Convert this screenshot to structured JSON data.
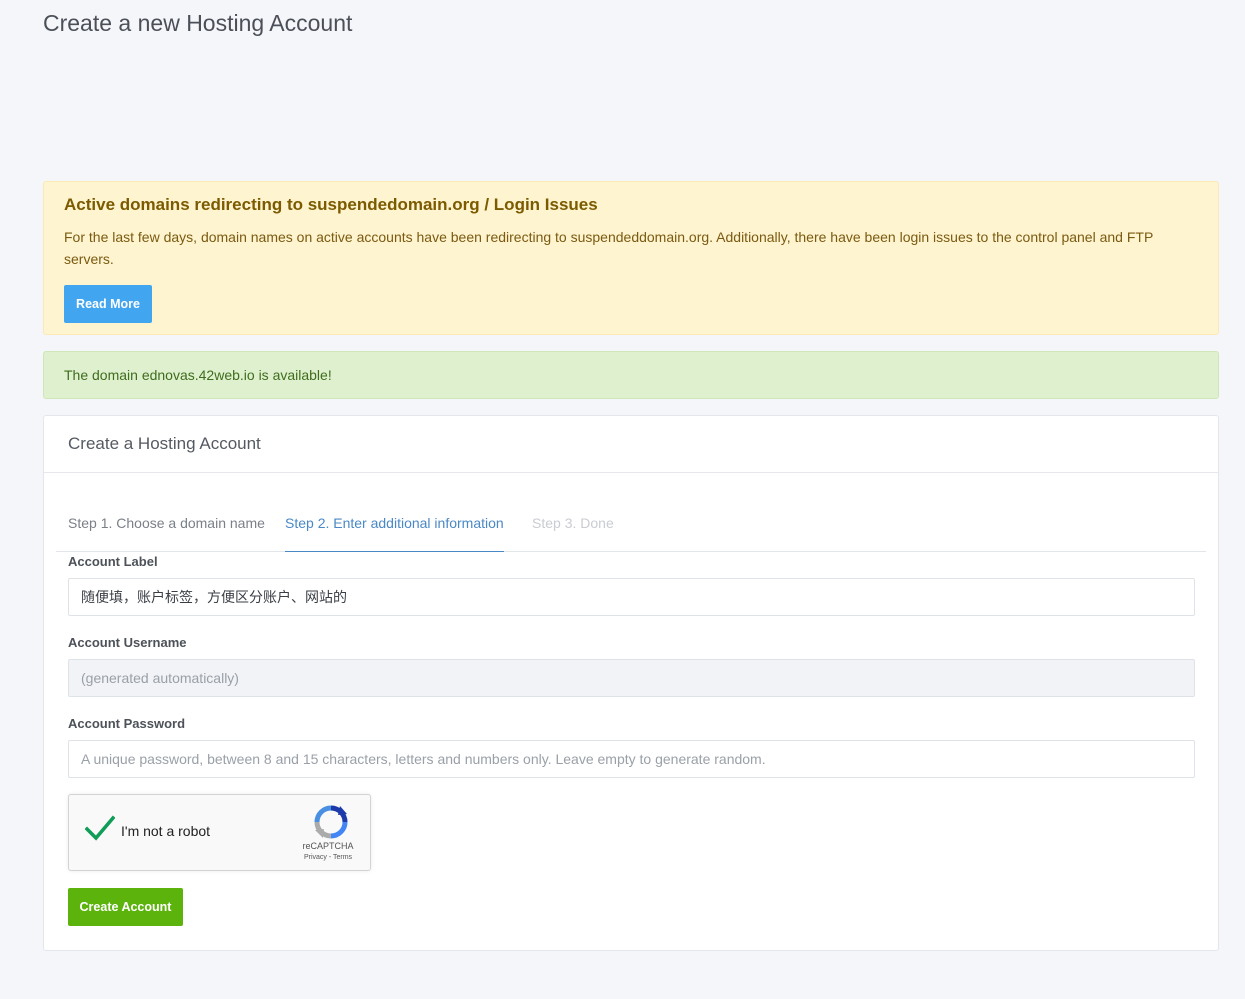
{
  "page": {
    "title": "Create a new Hosting Account"
  },
  "notice": {
    "heading": "Active domains redirecting to suspendedomain.org / Login Issues",
    "body": "For the last few days, domain names on active accounts have been redirecting to suspendeddomain.org. Additionally, there have been login issues to the control panel and FTP servers.",
    "button_label": "Read More"
  },
  "availability": {
    "message": "The domain ednovas.42web.io is available!"
  },
  "card": {
    "title": "Create a Hosting Account",
    "steps": [
      {
        "label": "Step 1. Choose a domain name",
        "state": "done"
      },
      {
        "label": "Step 2. Enter additional information",
        "state": "active"
      },
      {
        "label": "Step 3. Done",
        "state": "todo"
      }
    ]
  },
  "form": {
    "label_field": {
      "label": "Account Label",
      "value": "随便填，账户标签，方便区分账户、网站的"
    },
    "username_field": {
      "label": "Account Username",
      "placeholder": "(generated automatically)"
    },
    "password_field": {
      "label": "Account Password",
      "placeholder": "A unique password, between 8 and 15 characters, letters and numbers only. Leave empty to generate random."
    },
    "captcha": {
      "text": "I'm not a robot",
      "brand": "reCAPTCHA",
      "links": "Privacy - Terms",
      "checked": true
    },
    "submit_label": "Create Account"
  },
  "colors": {
    "accent_blue": "#42a5f0",
    "success_green": "#5cb30c",
    "warning_bg": "#fef4cf",
    "success_bg": "#dff0cf",
    "active_step": "#4a88c6"
  }
}
